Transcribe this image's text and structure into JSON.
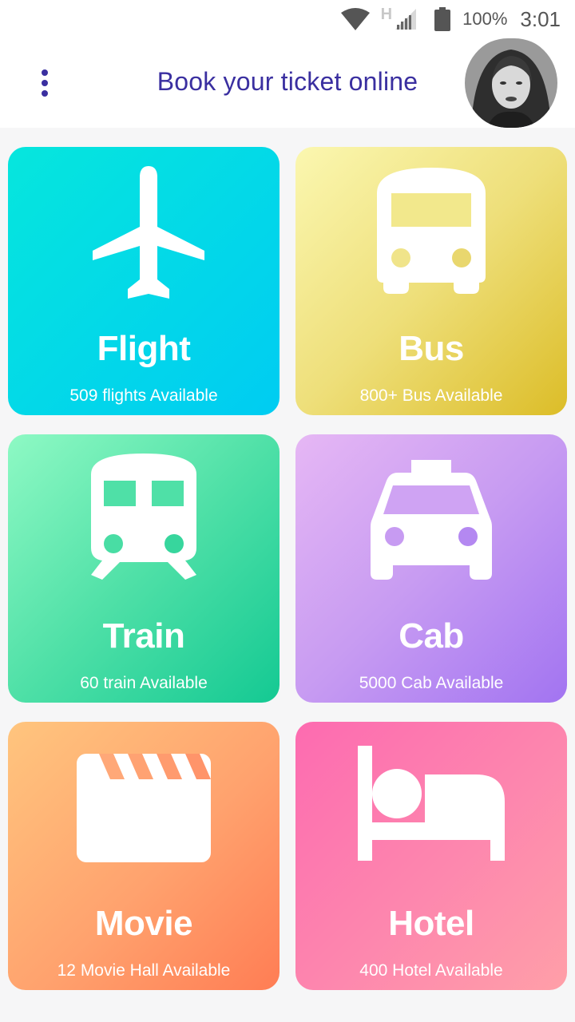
{
  "status_bar": {
    "network_type": "H",
    "battery_percent": "100%",
    "time": "3:01",
    "icons": [
      "wifi-icon",
      "signal-icon",
      "battery-icon"
    ]
  },
  "header": {
    "title": "Book your ticket online",
    "menu_icon": "more-vert-icon",
    "avatar_icon": "user-avatar"
  },
  "colors": {
    "accent": "#3a2fa0",
    "flight": [
      "#06e6dd",
      "#00ccf2"
    ],
    "bus": [
      "#fbf7b0",
      "#dcbd28"
    ],
    "train": [
      "#8ef9c4",
      "#14c993"
    ],
    "cab": [
      "#e6b7f4",
      "#a274f1"
    ],
    "movie": [
      "#ffc57e",
      "#ff7d54"
    ],
    "hotel": [
      "#fd6bb0",
      "#ff9fa8"
    ]
  },
  "categories": [
    {
      "key": "flight",
      "title": "Flight",
      "subtitle": "509 flights Available",
      "icon": "airplane-icon"
    },
    {
      "key": "bus",
      "title": "Bus",
      "subtitle": "800+ Bus Available",
      "icon": "bus-icon"
    },
    {
      "key": "train",
      "title": "Train",
      "subtitle": "60 train Available",
      "icon": "train-icon"
    },
    {
      "key": "cab",
      "title": "Cab",
      "subtitle": "5000 Cab Available",
      "icon": "taxi-icon"
    },
    {
      "key": "movie",
      "title": "Movie",
      "subtitle": "12 Movie Hall Available",
      "icon": "clapperboard-icon"
    },
    {
      "key": "hotel",
      "title": "Hotel",
      "subtitle": "400 Hotel Available",
      "icon": "bed-icon"
    }
  ]
}
